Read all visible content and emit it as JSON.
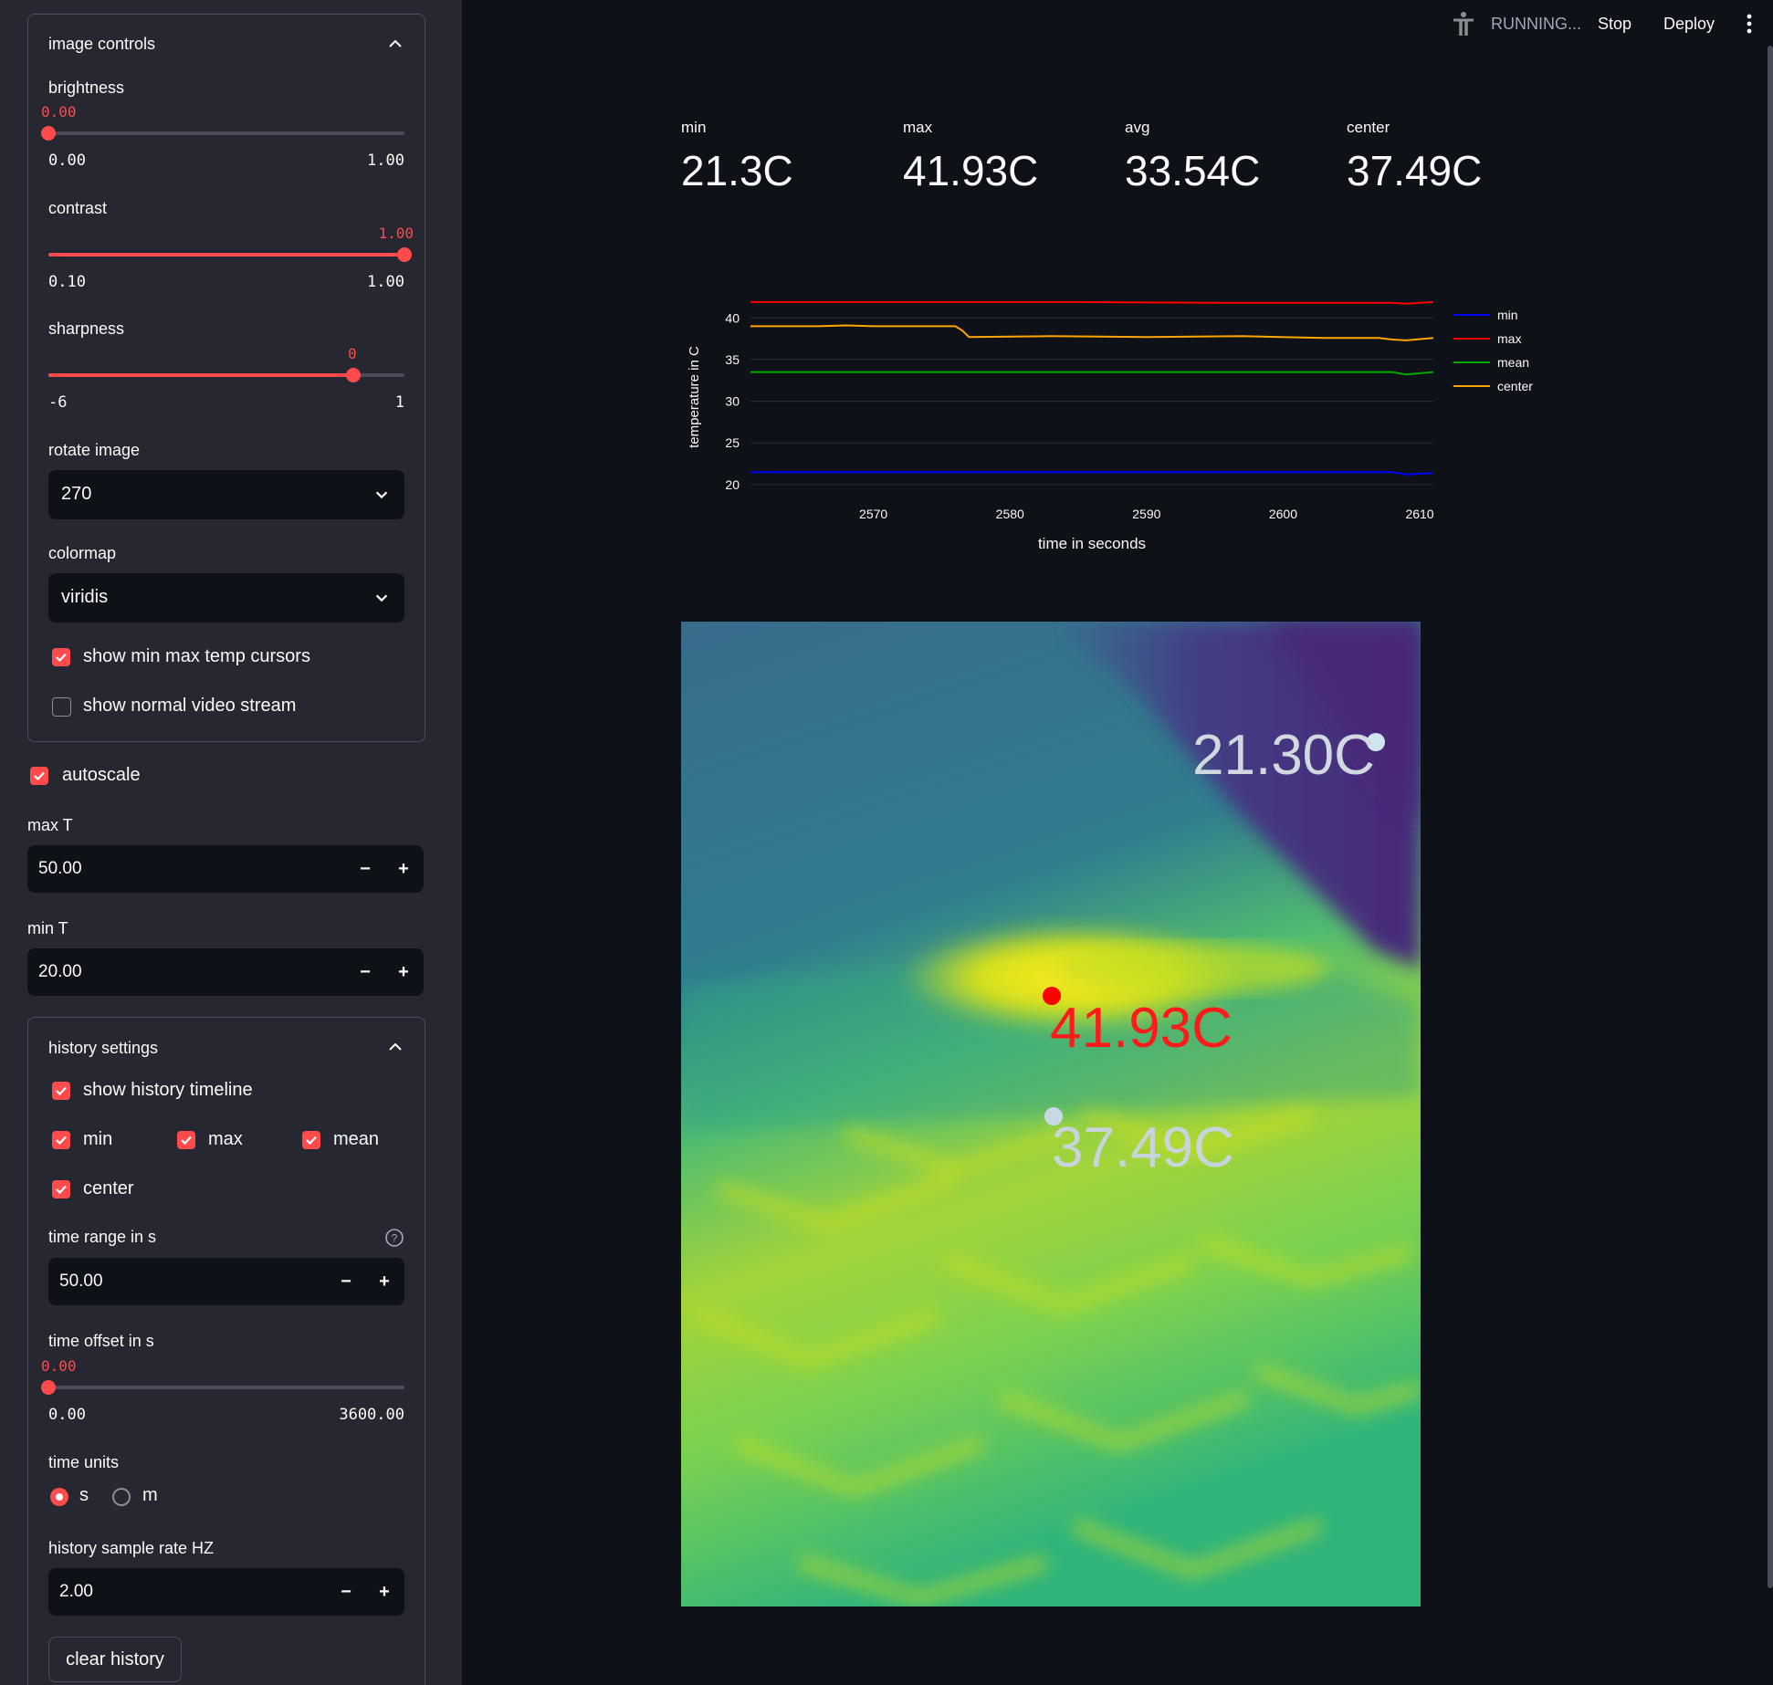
{
  "header": {
    "status": "RUNNING...",
    "stop_label": "Stop",
    "deploy_label": "Deploy"
  },
  "sidebar": {
    "image_controls": {
      "title": "image controls",
      "brightness": {
        "label": "brightness",
        "value": "0.00",
        "min": "0.00",
        "max": "1.00",
        "fraction": 0.0
      },
      "contrast": {
        "label": "contrast",
        "value": "1.00",
        "min": "0.10",
        "max": "1.00",
        "fraction": 1.0
      },
      "sharpness": {
        "label": "sharpness",
        "value": "0",
        "min": "-6",
        "max": "1",
        "fraction": 0.857
      },
      "rotate": {
        "label": "rotate image",
        "value": "270"
      },
      "colormap": {
        "label": "colormap",
        "value": "viridis"
      },
      "cursors": {
        "label": "show min max temp cursors",
        "checked": true
      },
      "normal_stream": {
        "label": "show normal video stream",
        "checked": false
      }
    },
    "autoscale": {
      "label": "autoscale",
      "checked": true
    },
    "max_t": {
      "label": "max T",
      "value": "50.00"
    },
    "min_t": {
      "label": "min T",
      "value": "20.00"
    },
    "history": {
      "title": "history settings",
      "show_timeline": {
        "label": "show history timeline",
        "checked": true
      },
      "min": {
        "label": "min",
        "checked": true
      },
      "max": {
        "label": "max",
        "checked": true
      },
      "mean": {
        "label": "mean",
        "checked": true
      },
      "center": {
        "label": "center",
        "checked": true
      },
      "time_range": {
        "label": "time range in s",
        "value": "50.00"
      },
      "time_offset": {
        "label": "time offset in s",
        "value": "0.00",
        "min": "0.00",
        "max": "3600.00",
        "fraction": 0.0
      },
      "time_units": {
        "label": "time units",
        "options": [
          "s",
          "m"
        ],
        "selected": "s"
      },
      "sample_rate": {
        "label": "history sample rate HZ",
        "value": "2.00"
      },
      "clear_label": "clear history"
    }
  },
  "metrics": [
    {
      "label": "min",
      "value": "21.3C"
    },
    {
      "label": "max",
      "value": "41.93C"
    },
    {
      "label": "avg",
      "value": "33.54C"
    },
    {
      "label": "center",
      "value": "37.49C"
    }
  ],
  "chart_data": {
    "type": "line",
    "xlabel": "time in seconds",
    "ylabel": "temperature in C",
    "xlim": [
      2561,
      2611
    ],
    "ylim": [
      19,
      42
    ],
    "xticks": [
      2570,
      2580,
      2590,
      2600,
      2610
    ],
    "yticks": [
      20,
      25,
      30,
      35,
      40
    ],
    "legend_position": "right",
    "series": [
      {
        "name": "min",
        "color": "#0000ff",
        "x": [
          2561,
          2575,
          2590,
          2605,
          2608,
          2609,
          2611
        ],
        "y": [
          21.5,
          21.5,
          21.5,
          21.5,
          21.5,
          21.2,
          21.4
        ]
      },
      {
        "name": "max",
        "color": "#ff0000",
        "x": [
          2561,
          2575,
          2585,
          2595,
          2608,
          2609,
          2611
        ],
        "y": [
          41.9,
          41.9,
          41.9,
          41.8,
          41.8,
          41.7,
          41.9
        ]
      },
      {
        "name": "mean",
        "color": "#00aa00",
        "x": [
          2561,
          2575,
          2590,
          2605,
          2608,
          2609,
          2611
        ],
        "y": [
          33.5,
          33.5,
          33.5,
          33.5,
          33.5,
          33.2,
          33.5
        ]
      },
      {
        "name": "center",
        "color": "#ffa500",
        "x": [
          2561,
          2566,
          2568,
          2570,
          2576,
          2576.5,
          2577,
          2583,
          2590,
          2597,
          2603,
          2607,
          2608,
          2609,
          2611
        ],
        "y": [
          39.0,
          39.0,
          39.1,
          39.0,
          39.0,
          38.5,
          37.7,
          37.8,
          37.7,
          37.8,
          37.6,
          37.6,
          37.4,
          37.3,
          37.6
        ]
      }
    ]
  },
  "thermal": {
    "min_label": "21.30C",
    "max_label": "41.93C",
    "center_label": "37.49C"
  },
  "colors": {
    "accent": "#ff4b4b",
    "background": "#0e1117",
    "sidebar": "#262730"
  }
}
